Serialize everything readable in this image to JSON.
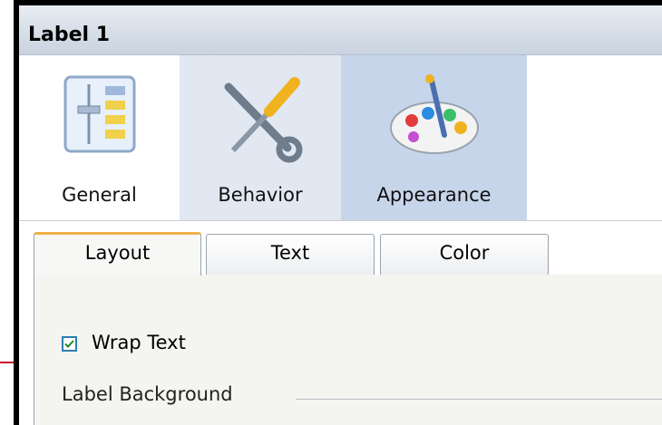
{
  "window": {
    "title": "Label 1"
  },
  "categories": [
    {
      "label": "General",
      "icon": "sliders-panel-icon"
    },
    {
      "label": "Behavior",
      "icon": "wrench-screwdriver-icon"
    },
    {
      "label": "Appearance",
      "icon": "paint-palette-icon"
    }
  ],
  "tabs": [
    {
      "label": "Layout",
      "selected": true
    },
    {
      "label": "Text",
      "selected": false
    },
    {
      "label": "Color",
      "selected": false
    }
  ],
  "layout": {
    "wrap_text": {
      "label": "Wrap Text",
      "checked": true
    },
    "background_group": {
      "label": "Label Background"
    }
  },
  "colors": {
    "active_tab_accent": "#f0b24a",
    "selected_category": "#c7d5ea",
    "annotation_line": "#c8102e"
  }
}
